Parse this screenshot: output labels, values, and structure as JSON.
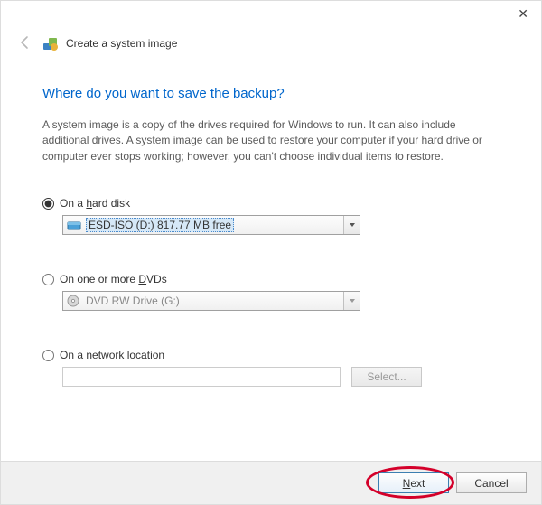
{
  "window": {
    "title": "Create a system image"
  },
  "heading": "Where do you want to save the backup?",
  "description": "A system image is a copy of the drives required for Windows to run. It can also include additional drives. A system image can be used to restore your computer if your hard drive or computer ever stops working; however, you can't choose individual items to restore.",
  "options": {
    "hard_disk": {
      "label_pre": "On a ",
      "label_u": "h",
      "label_post": "ard disk",
      "selected": "ESD-ISO (D:)  817.77 MB free"
    },
    "dvd": {
      "label_pre": "On one or more ",
      "label_u": "D",
      "label_post": "VDs",
      "selected": "DVD RW Drive (G:)"
    },
    "network": {
      "label_pre": "On a ne",
      "label_u": "t",
      "label_post": "work location",
      "value": "",
      "select_btn": "Select..."
    }
  },
  "footer": {
    "next_u": "N",
    "next_post": "ext",
    "cancel": "Cancel"
  }
}
